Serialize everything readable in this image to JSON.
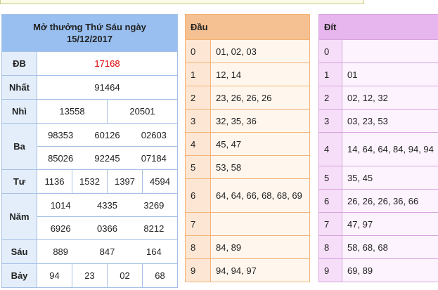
{
  "results": {
    "title_line1": "Mở thưởng Thứ Sáu ngày",
    "title_line2": "15/12/2017",
    "db": {
      "label": "ĐB",
      "values": [
        "17168"
      ]
    },
    "nhat": {
      "label": "Nhất",
      "values": [
        "91464"
      ]
    },
    "nhi": {
      "label": "Nhì",
      "values": [
        "13558",
        "20501"
      ]
    },
    "ba": {
      "label": "Ba",
      "values": [
        "98353",
        "60126",
        "02603",
        "85026",
        "92245",
        "07184"
      ]
    },
    "tu": {
      "label": "Tư",
      "values": [
        "1136",
        "1532",
        "1397",
        "4594"
      ]
    },
    "nam": {
      "label": "Năm",
      "values": [
        "1014",
        "4335",
        "3269",
        "6926",
        "0366",
        "8212"
      ]
    },
    "sau": {
      "label": "Sáu",
      "values": [
        "889",
        "847",
        "164"
      ]
    },
    "bay": {
      "label": "Bảy",
      "values": [
        "94",
        "23",
        "02",
        "68"
      ]
    },
    "colors": {
      "header": "#98bff0",
      "special": "#e00000"
    }
  },
  "dau": {
    "header": "Đầu",
    "rows": [
      {
        "k": "0",
        "v": "01, 02, 03"
      },
      {
        "k": "1",
        "v": "12, 14"
      },
      {
        "k": "2",
        "v": "23, 26, 26, 26"
      },
      {
        "k": "3",
        "v": "32, 35, 36"
      },
      {
        "k": "4",
        "v": "45, 47"
      },
      {
        "k": "5",
        "v": "53, 58"
      },
      {
        "k": "6",
        "v": "64, 64, 66, 68, 68, 69"
      },
      {
        "k": "7",
        "v": ""
      },
      {
        "k": "8",
        "v": "84, 89"
      },
      {
        "k": "9",
        "v": "94, 94, 97"
      }
    ],
    "color": "#f6c192"
  },
  "dit": {
    "header": "Đít",
    "rows": [
      {
        "k": "0",
        "v": ""
      },
      {
        "k": "1",
        "v": "01"
      },
      {
        "k": "2",
        "v": "02, 12, 32"
      },
      {
        "k": "3",
        "v": "03, 23, 53"
      },
      {
        "k": "4",
        "v": "14, 64, 64, 84, 94, 94"
      },
      {
        "k": "5",
        "v": "35, 45"
      },
      {
        "k": "6",
        "v": "26, 26, 26, 36, 66"
      },
      {
        "k": "7",
        "v": "47, 97"
      },
      {
        "k": "8",
        "v": "58, 68, 68"
      },
      {
        "k": "9",
        "v": "69, 89"
      }
    ],
    "color": "#e8b6ee"
  }
}
